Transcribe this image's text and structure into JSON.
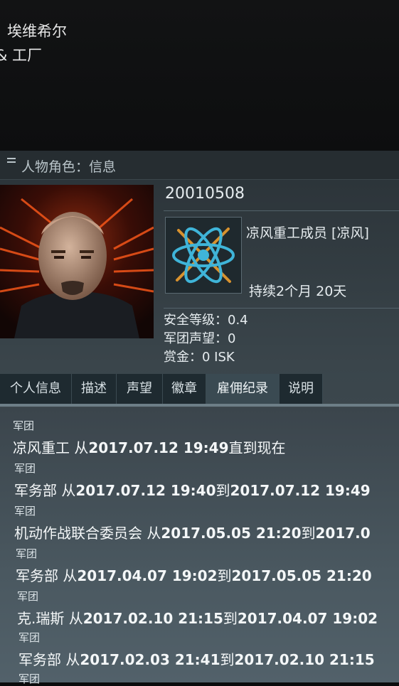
{
  "location": {
    "line1": "埃维希尔",
    "line2": "& 工厂"
  },
  "window": {
    "title": "人物角色：信息"
  },
  "character": {
    "id": "20010508",
    "corp_membership": "凉风重工成员 [凉风]",
    "duration": "持续2个月 20天",
    "security_status": "安全等级：0.4",
    "corp_standing": "军团声望：0",
    "bounty": "赏金：0 ISK"
  },
  "tabs": [
    {
      "label": "个人信息"
    },
    {
      "label": "描述"
    },
    {
      "label": "声望"
    },
    {
      "label": "徽章"
    },
    {
      "label": "雇佣纪录"
    },
    {
      "label": "说明"
    }
  ],
  "active_tab": "雇佣纪录",
  "history": [
    {
      "label": "军团",
      "name": "凉风重工",
      "from_word": " 从",
      "start": "2017.07.12 19:49",
      "to_word": "直到现在",
      "end": ""
    },
    {
      "label": "军团",
      "name": "军务部",
      "from_word": " 从",
      "start": "2017.07.12 19:40",
      "to_word": "到",
      "end": "2017.07.12 19:49"
    },
    {
      "label": "军团",
      "name": "机动作战联合委员会",
      "from_word": " 从",
      "start": "2017.05.05 21:20",
      "to_word": "到",
      "end": "2017.0"
    },
    {
      "label": "军团",
      "name": "军务部",
      "from_word": " 从",
      "start": "2017.04.07 19:02",
      "to_word": "到",
      "end": "2017.05.05 21:20"
    },
    {
      "label": "军团",
      "name": "克.瑞斯",
      "from_word": " 从",
      "start": "2017.02.10 21:15",
      "to_word": "到",
      "end": "2017.04.07 19:02"
    },
    {
      "label": "军团",
      "name": "军务部",
      "from_word": " 从",
      "start": "2017.02.03 21:41",
      "to_word": "到",
      "end": "2017.02.10 21:15"
    },
    {
      "label": "军团"
    }
  ]
}
